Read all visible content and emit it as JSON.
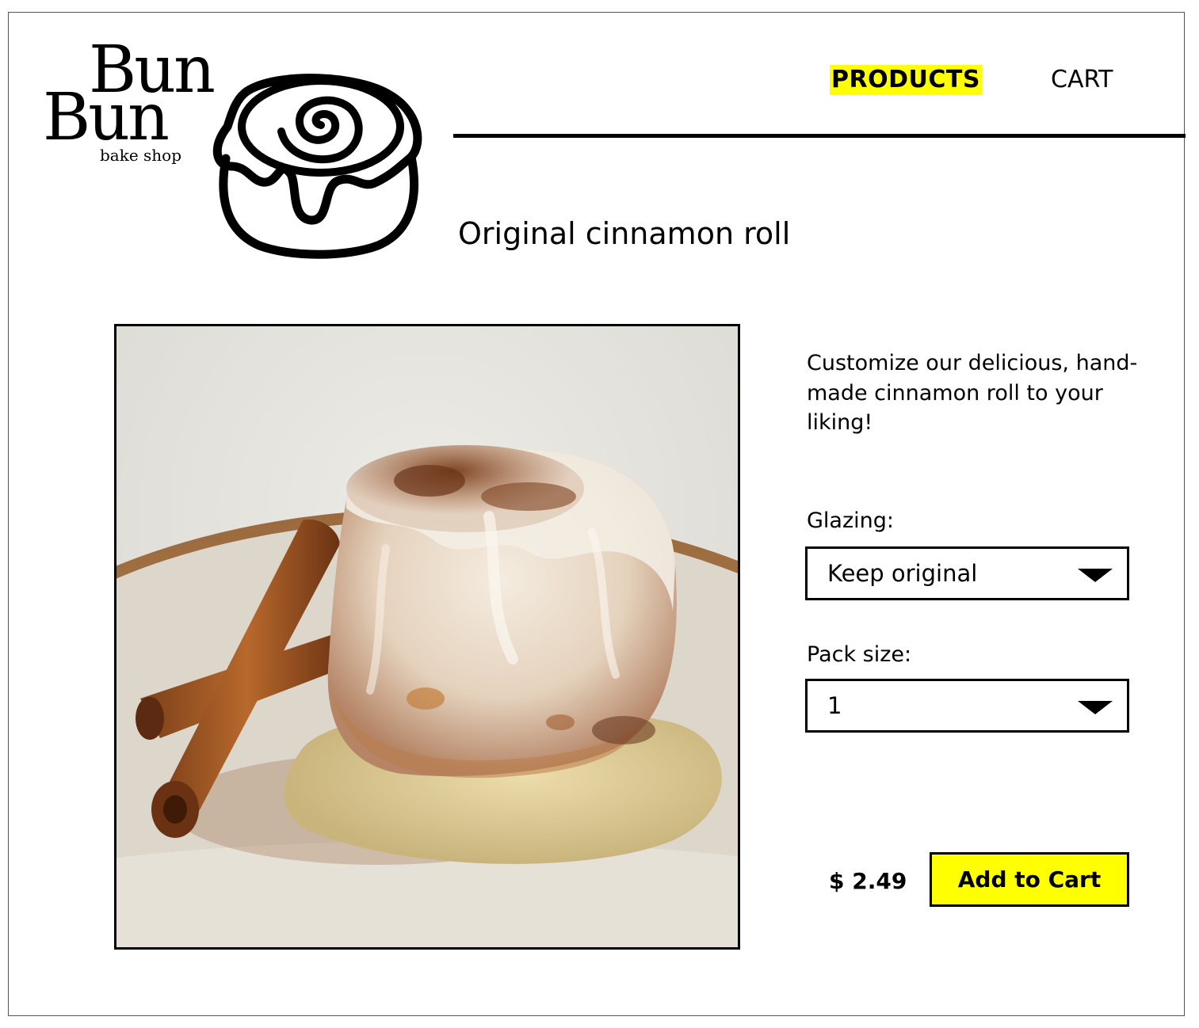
{
  "logo": {
    "word_top": "Bun",
    "word_bottom": "Bun",
    "subtitle": "bake shop"
  },
  "nav": {
    "products_label": "PRODUCTS",
    "cart_label": "CART"
  },
  "product": {
    "title": "Original cinnamon roll",
    "description": "Customize our delicious, hand-made cinnamon roll to your liking!",
    "glazing": {
      "label": "Glazing:",
      "selected": "Keep original"
    },
    "pack_size": {
      "label": "Pack size:",
      "selected": "1"
    },
    "price": "$ 2.49",
    "add_to_cart_label": "Add to Cart"
  },
  "colors": {
    "accent": "#ffff00",
    "text": "#000000",
    "background": "#ffffff"
  },
  "icons": [
    "cinnamon-bun-logo-icon",
    "chevron-down-icon"
  ]
}
